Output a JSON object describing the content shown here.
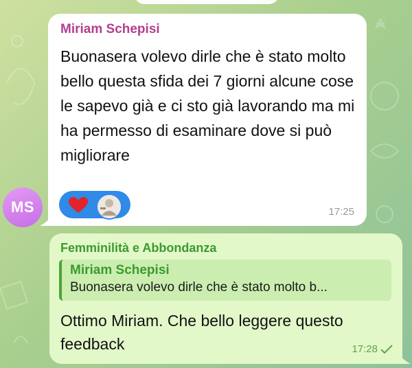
{
  "avatar": {
    "initials": "MS",
    "color_top": "#e49af2",
    "color_bottom": "#c56ee8"
  },
  "incoming": {
    "sender": "Miriam Schepisi",
    "sender_color": "#b43e8d",
    "text": "Buonasera volevo dirle che è stato molto bello questa sfida dei 7 giorni alcune cose le sapevo già e ci sto già lavorando ma mi ha permesso di esaminare dove si può migliorare",
    "time": "17:25",
    "reactions": [
      {
        "icon": "heart-icon",
        "color": "#e2232b"
      },
      {
        "icon": "user-avatar"
      }
    ],
    "reaction_bg": "#2f8ae8"
  },
  "outgoing": {
    "sender": "Femminilità e Abbondanza",
    "sender_color": "#3c9a2f",
    "quote": {
      "name": "Miriam Schepisi",
      "text": "Buonasera volevo dirle che è stato molto b..."
    },
    "text": "Ottimo Miriam. Che bello leggere questo feedback",
    "time": "17:28",
    "status_icon": "check-icon",
    "bubble_color": "#e3f8c9"
  }
}
